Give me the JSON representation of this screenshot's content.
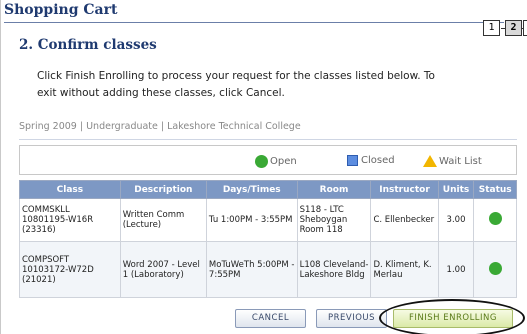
{
  "header": {
    "cart_title": "Shopping Cart",
    "steps": [
      "1",
      "2",
      "3"
    ]
  },
  "section": {
    "title": "2.  Confirm classes",
    "instructions": "Click Finish Enrolling to process your request for the classes listed below. To exit without adding these classes, click Cancel."
  },
  "term": {
    "text": "Spring 2009 | Undergraduate | Lakeshore Technical College"
  },
  "legend": {
    "open": "Open",
    "closed": "Closed",
    "wait_list": "Wait List"
  },
  "table": {
    "headers": [
      "Class",
      "Description",
      "Days/Times",
      "Room",
      "Instructor",
      "Units",
      "Status"
    ],
    "rows": [
      {
        "class": "COMMSKLL 10801195-W16R (23316)",
        "description": "Written Comm (Lecture)",
        "days_times": "Tu 1:00PM - 3:55PM",
        "room": "S118 - LTC Sheboygan Room 118",
        "instructor": "C. Ellenbecker",
        "units": "3.00",
        "status": "open"
      },
      {
        "class": "COMPSOFT 10103172-W72D (21021)",
        "description": "Word 2007 - Level 1 (Laboratory)",
        "days_times": "MoTuWeTh 5:00PM - 7:55PM",
        "room": "L108 Cleveland-Lakeshore Bldg",
        "instructor": "D. Kliment, K. Merlau",
        "units": "1.00",
        "status": "open"
      }
    ]
  },
  "buttons": {
    "cancel": "CANCEL",
    "previous": "PREVIOUS",
    "finish": "FINISH ENROLLING"
  },
  "colors": {
    "title": "#1f3a70",
    "table_header": "#7d98c4",
    "open_status": "#3aa935",
    "closed_status": "#5c8de0",
    "wait_list_status": "#f2b600"
  }
}
